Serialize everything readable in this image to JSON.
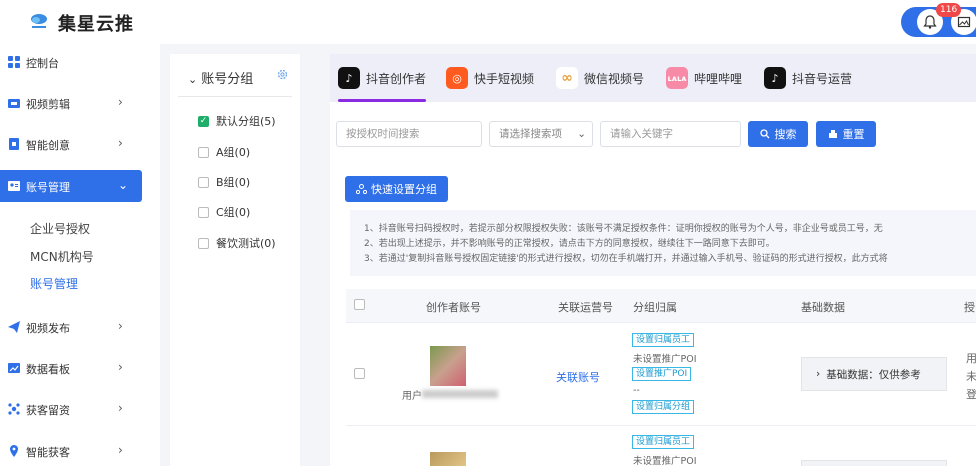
{
  "app": {
    "title": "集星云推",
    "notification_count": "116"
  },
  "sidebar": {
    "items": [
      {
        "label": "控制台"
      },
      {
        "label": "视频剪辑"
      },
      {
        "label": "智能创意"
      },
      {
        "label": "账号管理"
      },
      {
        "label": "视频发布"
      },
      {
        "label": "数据看板"
      },
      {
        "label": "获客留资"
      },
      {
        "label": "智能获客"
      }
    ],
    "subitems": [
      {
        "label": "企业号授权"
      },
      {
        "label": "MCN机构号"
      },
      {
        "label": "账号管理"
      }
    ]
  },
  "groups": {
    "title": "账号分组",
    "items": [
      {
        "label": "默认分组(5)",
        "checked": true
      },
      {
        "label": "A组(0)",
        "checked": false
      },
      {
        "label": "B组(0)",
        "checked": false
      },
      {
        "label": "C组(0)",
        "checked": false
      },
      {
        "label": "餐饮测试(0)",
        "checked": false
      }
    ]
  },
  "tabs": [
    {
      "label": "抖音创作者",
      "icon": "douyin-icon"
    },
    {
      "label": "快手短视频",
      "icon": "kuaishou-icon"
    },
    {
      "label": "微信视频号",
      "icon": "wechat-channels-icon"
    },
    {
      "label": "哔哩哔哩",
      "icon": "bilibili-icon"
    },
    {
      "label": "抖音号运营",
      "icon": "douyin-icon"
    }
  ],
  "search": {
    "time_placeholder": "按授权时间搜索",
    "select_placeholder": "请选择搜索项",
    "keyword_placeholder": "请输入关键字",
    "search_label": "搜索",
    "reset_label": "重置"
  },
  "quick_group_label": "快速设置分组",
  "notice": {
    "line1": "1、抖音账号扫码授权时，若提示部分权限授权失败：该账号不满足授权条件：证明你授权的账号为个人号，非企业号或员工号，无",
    "line2": "2、若出现上述提示，并不影响账号的正常授权，请点击下方的同意授权，继续往下一路同意下去即可。",
    "line3": "3、若通过'复制抖音账号授权固定链接'的形式进行授权，切勿在手机端打开，并通过输入手机号、验证码的形式进行授权，此方式将"
  },
  "table": {
    "headers": {
      "creator": "创作者账号",
      "ops": "关联运营号",
      "group": "分组归属",
      "basic": "基础数据",
      "more": "授"
    },
    "row1": {
      "user_prefix": "用户",
      "ops_link": "关联账号",
      "tag_employee": "设置归属员工",
      "no_poi": "未设置推广POI",
      "tag_poi": "设置推广POI",
      "dashes": "--",
      "tag_group": "设置归属分组",
      "basic_label": "基础数据：仅供参考",
      "cut1": "用",
      "cut2": "未",
      "cut3": "登"
    },
    "row2": {
      "tag_employee": "设置归属员工",
      "no_poi": "未设置推广POI"
    }
  },
  "colors": {
    "primary": "#2f6fe8",
    "tab_accent": "#8a2be2",
    "check_green": "#1fae6a",
    "tag_blue": "#39b7e6"
  }
}
